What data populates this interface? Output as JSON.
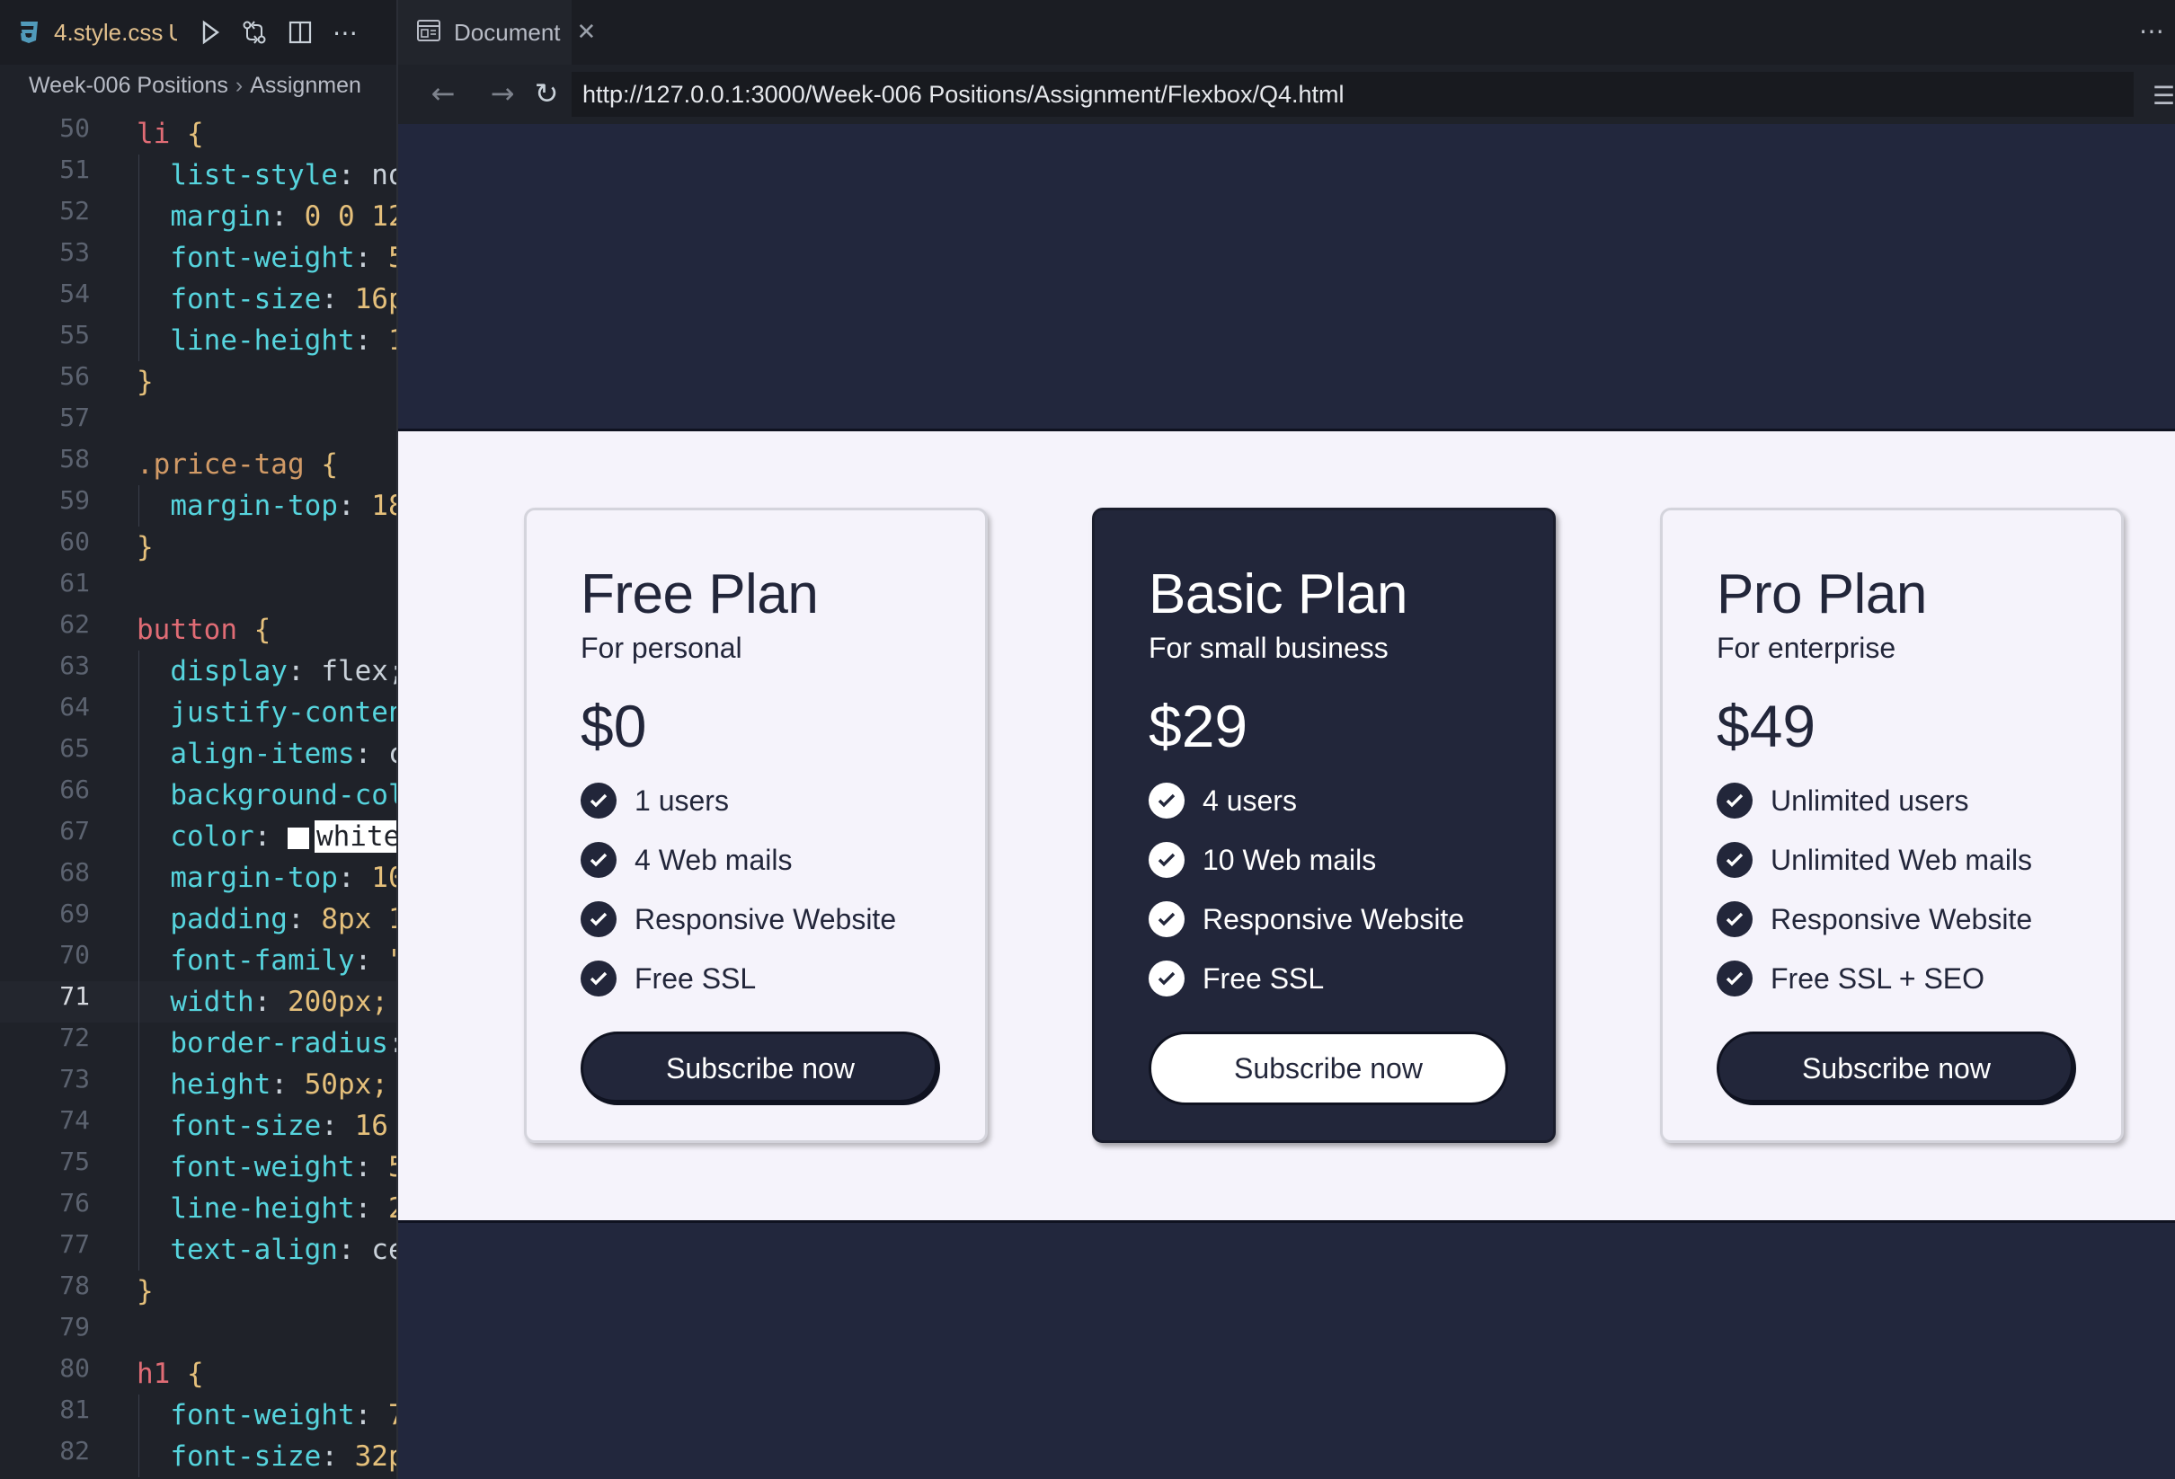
{
  "editor": {
    "tab_name": "4.style.css",
    "tab_modified": "U",
    "breadcrumb": [
      "Week-006 Positions",
      "Assignmen"
    ],
    "lines": [
      {
        "n": "50"
      },
      {
        "n": "51"
      },
      {
        "n": "52"
      },
      {
        "n": "53"
      },
      {
        "n": "54"
      },
      {
        "n": "55"
      },
      {
        "n": "56"
      },
      {
        "n": "57"
      },
      {
        "n": "58"
      },
      {
        "n": "59"
      },
      {
        "n": "60"
      },
      {
        "n": "61"
      },
      {
        "n": "62"
      },
      {
        "n": "63"
      },
      {
        "n": "64"
      },
      {
        "n": "65"
      },
      {
        "n": "66"
      },
      {
        "n": "67"
      },
      {
        "n": "68"
      },
      {
        "n": "69"
      },
      {
        "n": "70"
      },
      {
        "n": "71"
      },
      {
        "n": "72"
      },
      {
        "n": "73"
      },
      {
        "n": "74"
      },
      {
        "n": "75"
      },
      {
        "n": "76"
      },
      {
        "n": "77"
      },
      {
        "n": "78"
      },
      {
        "n": "79"
      },
      {
        "n": "80"
      },
      {
        "n": "81"
      },
      {
        "n": "82"
      }
    ],
    "code": {
      "l50_sel": "li",
      "l51_prop": "list-style",
      "l51_val": "no",
      "l52_prop": "margin",
      "l52_val": "0 0 12",
      "l53_prop": "font-weight",
      "l53_val": "5",
      "l54_prop": "font-size",
      "l54_val": "16p",
      "l55_prop": "line-height",
      "l55_val": "1",
      "l58_sel": ".price-tag",
      "l59_prop": "margin-top",
      "l59_val": "18",
      "l62_sel": "button",
      "l63_prop": "display",
      "l63_val": "flex;",
      "l64_prop": "justify-conten",
      "l65_prop": "align-items",
      "l65_val": "c",
      "l66_prop": "background-col",
      "l67_prop": "color",
      "l67_val": "white",
      "l68_prop": "margin-top",
      "l68_val": "10",
      "l69_prop": "padding",
      "l69_val": "8px 1",
      "l70_prop": "font-family",
      "l70_val": "\"",
      "l71_prop": "width",
      "l71_val": "200px;",
      "l72_prop": "border-radius",
      "l73_prop": "height",
      "l73_val": "50px;",
      "l74_prop": "font-size",
      "l74_val": "16",
      "l75_prop": "font-weight",
      "l75_val": "5",
      "l76_prop": "line-height",
      "l76_val": "2",
      "l77_prop": "text-align",
      "l77_val": "ce",
      "l80_sel": "h1",
      "l81_prop": "font-weight",
      "l81_val": "7",
      "l82_prop": "font-size",
      "l82_val": "32p"
    }
  },
  "browser": {
    "tab_title": "Document",
    "url": "http://127.0.0.1:3000/Week-006 Positions/Assignment/Flexbox/Q4.html"
  },
  "plans": [
    {
      "title": "Free Plan",
      "subtitle": "For personal",
      "price": "$0",
      "features": [
        "1 users",
        "4 Web mails",
        "Responsive Website",
        "Free SSL"
      ],
      "button": "Subscribe now"
    },
    {
      "title": "Basic Plan",
      "subtitle": "For small business",
      "price": "$29",
      "features": [
        "4 users",
        "10 Web mails",
        "Responsive Website",
        "Free SSL"
      ],
      "button": "Subscribe now"
    },
    {
      "title": "Pro Plan",
      "subtitle": "For enterprise",
      "price": "$49",
      "features": [
        "Unlimited users",
        "Unlimited Web mails",
        "Responsive Website",
        "Free SSL + SEO"
      ],
      "button": "Subscribe now"
    }
  ],
  "colors": {
    "navy": "#22263a",
    "page_bg": "#f5f3fb",
    "editor_bg": "#1f2229"
  }
}
